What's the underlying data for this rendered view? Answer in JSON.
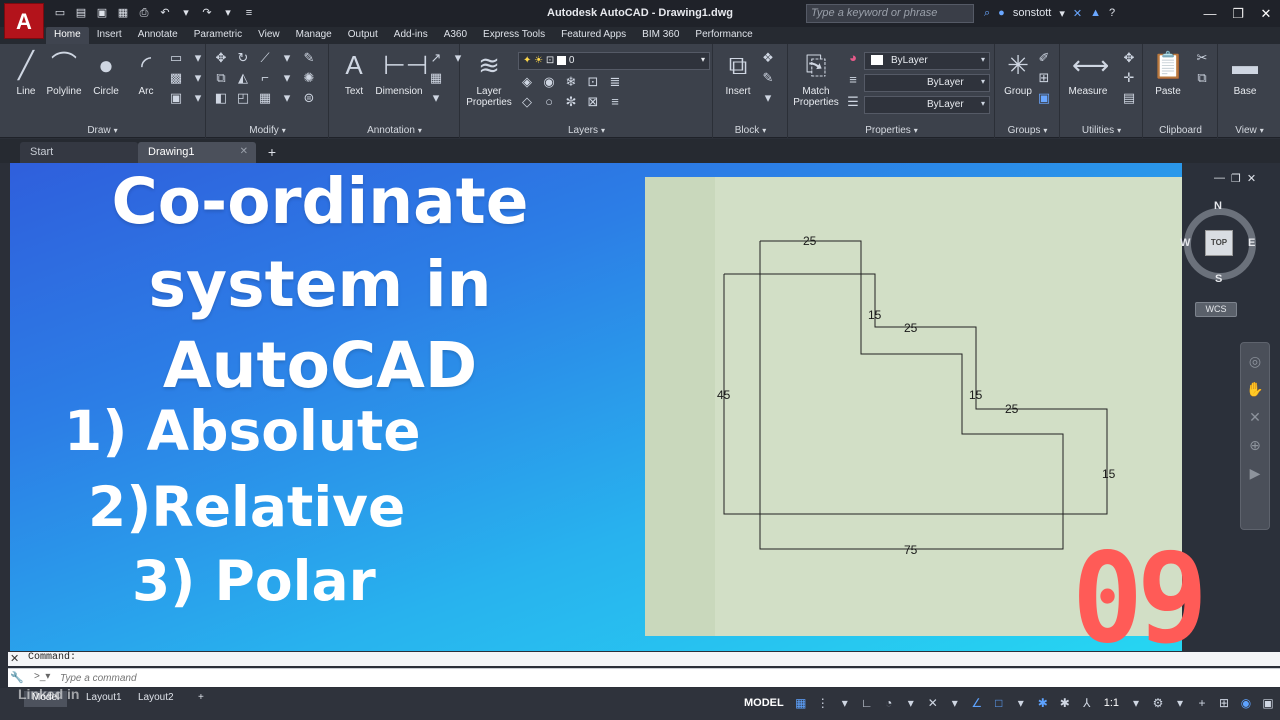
{
  "titlebar": {
    "app_logo": "A",
    "title": "Autodesk AutoCAD   -   Drawing1.dwg",
    "search_placeholder": "Type a keyword or phrase",
    "username": "sonstott"
  },
  "ribbon_tabs": [
    "Home",
    "Insert",
    "Annotate",
    "Parametric",
    "View",
    "Manage",
    "Output",
    "Add-ins",
    "A360",
    "Express Tools",
    "Featured Apps",
    "BIM 360",
    "Performance"
  ],
  "ribbon": {
    "draw": {
      "label": "Draw",
      "tools": [
        "Line",
        "Polyline",
        "Circle",
        "Arc"
      ]
    },
    "modify": {
      "label": "Modify"
    },
    "annotation": {
      "label": "Annotation",
      "tools": [
        "Text",
        "Dimension"
      ]
    },
    "layers": {
      "label": "Layers",
      "tool": "Layer Properties",
      "current_layer": "0"
    },
    "block": {
      "label": "Block",
      "tool": "Insert"
    },
    "properties": {
      "label": "Properties",
      "match_tool": "Match Properties",
      "color": "ByLayer",
      "linetype": "ByLayer",
      "lineweight": "ByLayer"
    },
    "groups": {
      "label": "Groups",
      "tool": "Group"
    },
    "utilities": {
      "label": "Utilities",
      "tool": "Measure"
    },
    "clipboard": {
      "label": "Clipboard",
      "tool": "Paste"
    },
    "view": {
      "label": "View",
      "tool": "Base"
    }
  },
  "file_tabs": [
    "Start",
    "Drawing1"
  ],
  "thumbnail": {
    "heading_lines": [
      "Co-ordinate",
      "system in",
      "AutoCAD"
    ],
    "items": [
      "1) Absolute",
      "2)Relative",
      "3) Polar"
    ],
    "episode": "09"
  },
  "drawing": {
    "dimensions": [
      "25",
      "15",
      "25",
      "15",
      "25",
      "15",
      "75",
      "45"
    ]
  },
  "viewcube": {
    "north": "N",
    "south": "S",
    "east": "E",
    "west": "W",
    "face": "TOP",
    "ucs": "WCS"
  },
  "command": {
    "history": "Command:",
    "placeholder": "Type a command"
  },
  "layout_tabs": [
    "Model",
    "Layout1",
    "Layout2"
  ],
  "watermark": "Linked in",
  "status": {
    "model_label": "MODEL",
    "scale": "1:1"
  }
}
